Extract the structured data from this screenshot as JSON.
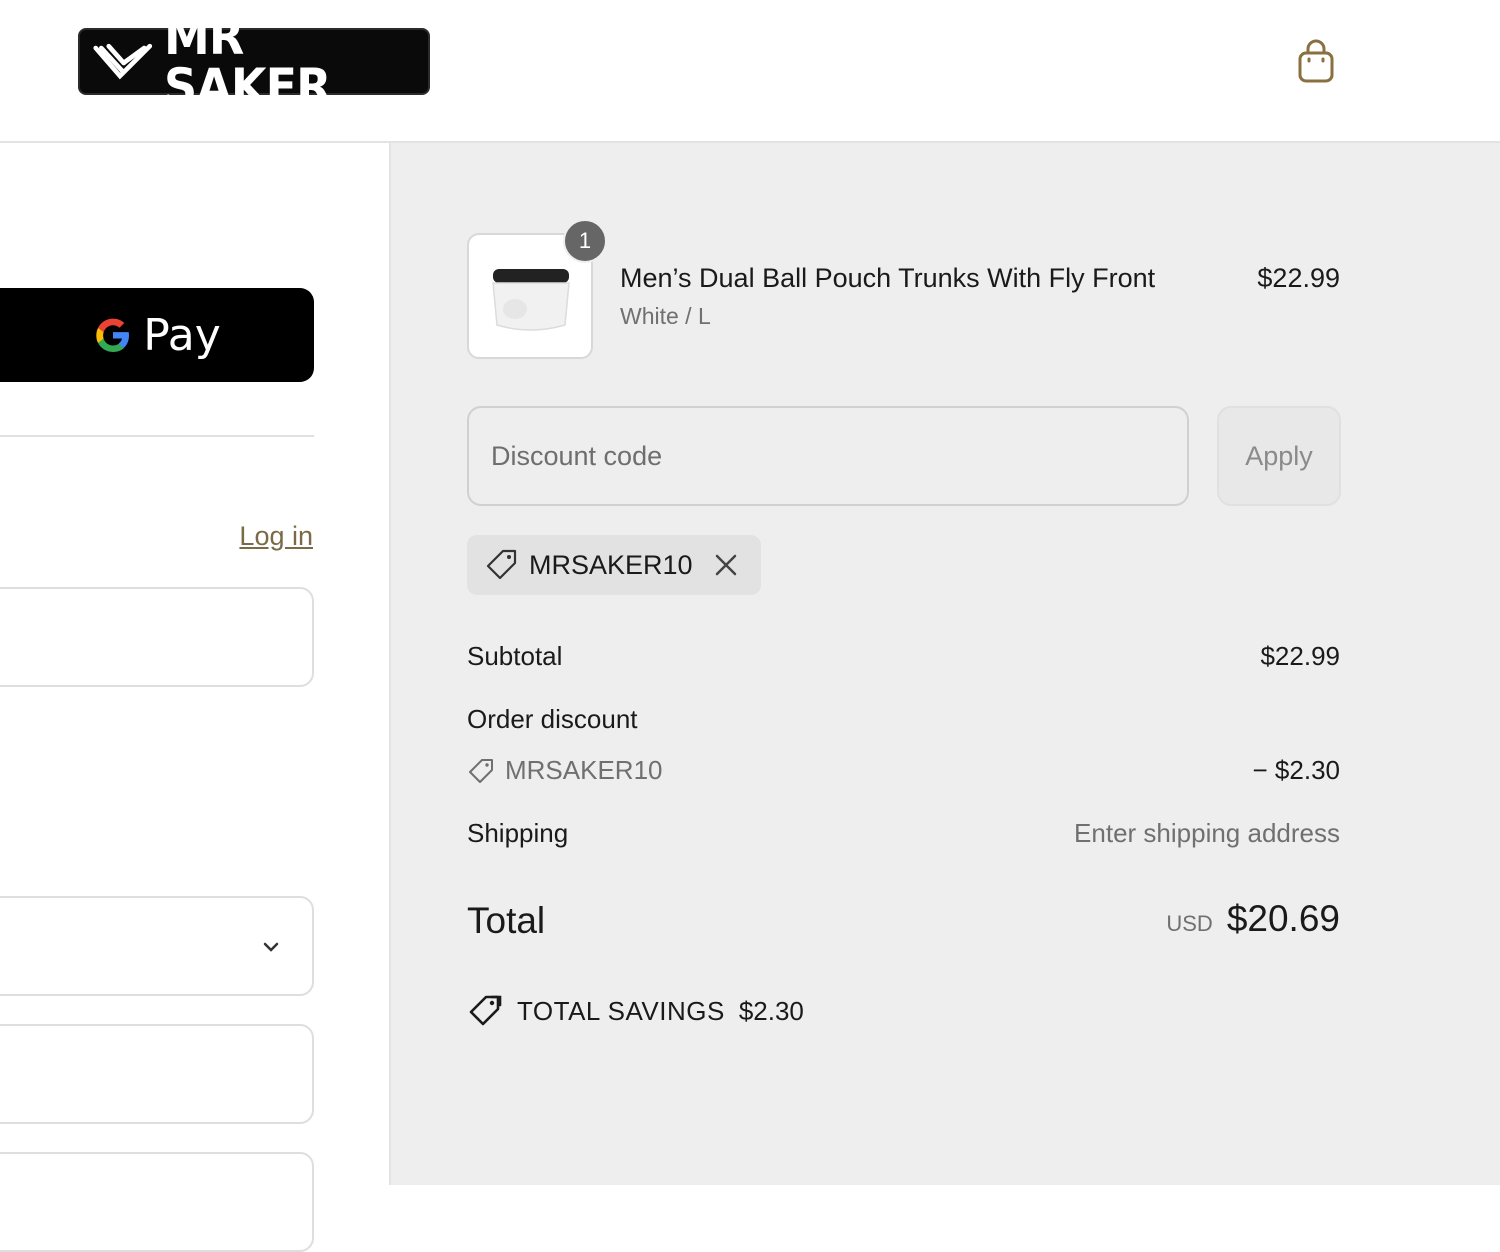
{
  "header": {
    "logo_text": "MR SAKER",
    "cart_icon": "shopping-bag-icon"
  },
  "checkout": {
    "gpay_label": "Pay",
    "login_label": "Log in"
  },
  "order": {
    "item": {
      "title": "Men’s Dual Ball Pouch Trunks With Fly Front",
      "variant": "White / L",
      "price": "$22.99",
      "quantity": "1"
    },
    "discount": {
      "placeholder": "Discount code",
      "apply_label": "Apply",
      "applied_code": "MRSAKER10"
    },
    "summary": {
      "subtotal_label": "Subtotal",
      "subtotal_value": "$22.99",
      "order_discount_label": "Order discount",
      "discount_code": "MRSAKER10",
      "discount_value": "− $2.30",
      "shipping_label": "Shipping",
      "shipping_value": "Enter shipping address",
      "total_label": "Total",
      "currency": "USD",
      "total_value": "$20.69"
    },
    "savings": {
      "label": "TOTAL SAVINGS",
      "amount": "$2.30"
    }
  },
  "colors": {
    "accent_link": "#7a6a45",
    "summary_bg": "#eeeeee",
    "gpay_bg": "#000000"
  }
}
